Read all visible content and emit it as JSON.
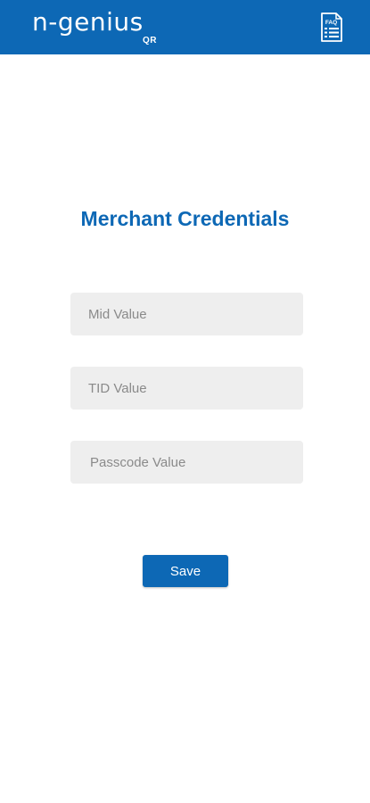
{
  "header": {
    "logo_text": "n-genius",
    "logo_sub": "QR",
    "faq_label": "FAQ",
    "background_color": "#0d68b5"
  },
  "main": {
    "title": "Merchant Credentials",
    "fields": {
      "mid": {
        "placeholder": "Mid Value",
        "value": ""
      },
      "tid": {
        "placeholder": "TID Value",
        "value": ""
      },
      "passcode": {
        "placeholder": "Passcode Value",
        "value": ""
      }
    },
    "save_label": "Save"
  },
  "colors": {
    "brand": "#0d68b5",
    "field_bg": "#eeeeee",
    "placeholder": "#8a8a8a"
  },
  "icons": {
    "faq": "faq-document-icon"
  }
}
